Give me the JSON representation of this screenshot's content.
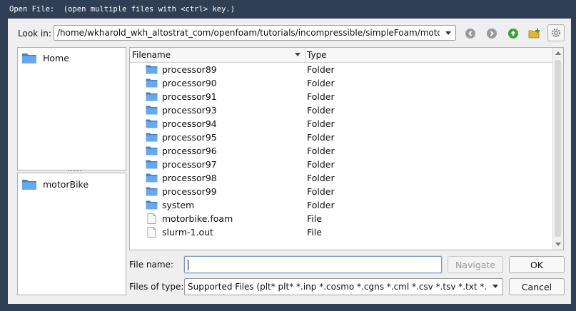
{
  "window": {
    "title": "Open File:  (open multiple files with <ctrl> key.)"
  },
  "toolbar": {
    "look_in_label": "Look in:",
    "path": "/home/wkharold_wkh_altostrat_com/openfoam/tutorials/incompressible/simpleFoam/motorBike",
    "icons": [
      "back-icon",
      "forward-icon",
      "parent-folder-icon",
      "new-folder-icon",
      "settings-gear-icon"
    ]
  },
  "sidebar": {
    "top": [
      {
        "label": "Home",
        "icon": "folder-icon"
      }
    ],
    "bottom": [
      {
        "label": "motorBike",
        "icon": "folder-icon"
      }
    ]
  },
  "filelist": {
    "columns": {
      "name": "Filename",
      "type": "Type"
    },
    "rows": [
      {
        "name": "processor89",
        "type": "Folder",
        "icon": "folder-icon"
      },
      {
        "name": "processor90",
        "type": "Folder",
        "icon": "folder-icon"
      },
      {
        "name": "processor91",
        "type": "Folder",
        "icon": "folder-icon"
      },
      {
        "name": "processor93",
        "type": "Folder",
        "icon": "folder-icon"
      },
      {
        "name": "processor94",
        "type": "Folder",
        "icon": "folder-icon"
      },
      {
        "name": "processor95",
        "type": "Folder",
        "icon": "folder-icon"
      },
      {
        "name": "processor96",
        "type": "Folder",
        "icon": "folder-icon"
      },
      {
        "name": "processor97",
        "type": "Folder",
        "icon": "folder-icon"
      },
      {
        "name": "processor98",
        "type": "Folder",
        "icon": "folder-icon"
      },
      {
        "name": "processor99",
        "type": "Folder",
        "icon": "folder-icon"
      },
      {
        "name": "system",
        "type": "Folder",
        "icon": "folder-icon"
      },
      {
        "name": "motorbike.foam",
        "type": "File",
        "icon": "file-icon"
      },
      {
        "name": "slurm-1.out",
        "type": "File",
        "icon": "file-icon"
      }
    ]
  },
  "form": {
    "file_name_label": "File name:",
    "file_name_value": "",
    "files_of_type_label": "Files of type:",
    "files_of_type_value": "Supported Files (plt* plt* *.inp *.cosmo *.cgns *.cml *.csv *.tsv *.txt *.CSV *.TSV *.TXT)",
    "navigate_label": "Navigate",
    "ok_label": "OK",
    "cancel_label": "Cancel"
  },
  "colors": {
    "titlebar": "#2f3f55",
    "folder": "#4a90d9",
    "green_arrow": "#3aa335"
  }
}
